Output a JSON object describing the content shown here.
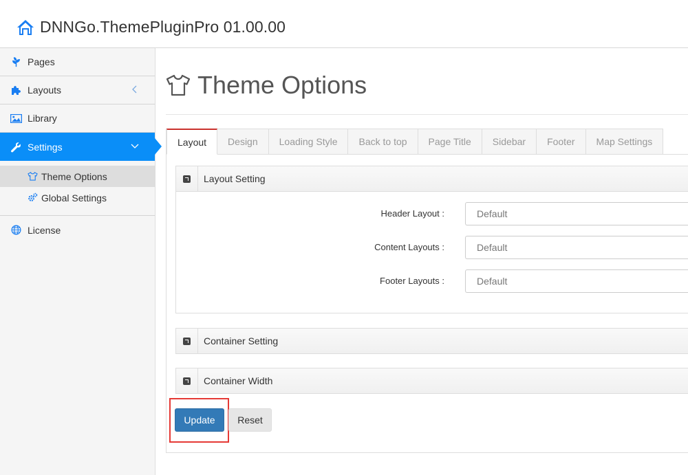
{
  "header": {
    "title": "DNNGo.ThemePluginPro 01.00.00"
  },
  "sidebar": {
    "items": [
      {
        "label": "Pages",
        "icon": "plant-icon"
      },
      {
        "label": "Layouts",
        "icon": "puzzle-icon"
      },
      {
        "label": "Library",
        "icon": "image-icon"
      },
      {
        "label": "Settings",
        "icon": "wrench-icon"
      },
      {
        "label": "License",
        "icon": "globe-icon"
      }
    ],
    "settings_sub": [
      {
        "label": "Theme Options",
        "icon": "shirt-icon"
      },
      {
        "label": "Global Settings",
        "icon": "cogs-icon"
      }
    ]
  },
  "main": {
    "title": "Theme Options",
    "tabs": [
      "Layout",
      "Design",
      "Loading Style",
      "Back to top",
      "Page Title",
      "Sidebar",
      "Footer",
      "Map Settings"
    ],
    "sections": {
      "layout_setting": {
        "title": "Layout Setting",
        "fields": [
          {
            "label": "Header Layout :",
            "value": "Default"
          },
          {
            "label": "Content Layouts :",
            "value": "Default"
          },
          {
            "label": "Footer Layouts :",
            "value": "Default"
          }
        ]
      },
      "container_setting": {
        "title": "Container Setting"
      },
      "container_width": {
        "title": "Container Width"
      }
    },
    "buttons": {
      "update": "Update",
      "reset": "Reset"
    }
  },
  "colors": {
    "accent": "#0a8ef8",
    "primary_button": "#337ab7",
    "active_tab_border": "#c9302c",
    "highlight": "#e53935"
  }
}
